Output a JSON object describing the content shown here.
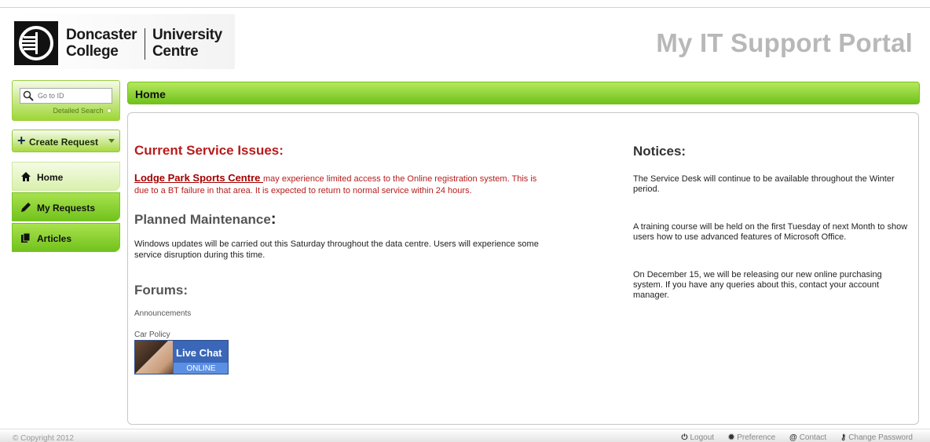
{
  "header": {
    "college_name": "Doncaster\nCollege",
    "university_name": "University\nCentre",
    "portal_title": "My IT Support Portal"
  },
  "sidebar": {
    "search_placeholder": "Go to ID",
    "detailed_search": "Detailed Search",
    "create_request": "Create Request",
    "items": [
      {
        "label": "Home",
        "icon": "home-icon"
      },
      {
        "label": "My Requests",
        "icon": "pencil-icon"
      },
      {
        "label": "Articles",
        "icon": "documents-icon"
      }
    ]
  },
  "main": {
    "page_title": "Home",
    "current_issues_title": "Current Service Issues:",
    "issue_link": "Lodge Park Sports Centre ",
    "issue_text": "may experience limited access to the Online registration system. This is due to a BT failure in that area. It is expected to return to normal service within 24 hours.",
    "planned_title": "Planned Maintenance",
    "planned_colon": ":",
    "planned_body": "Windows updates will be carried out this Saturday throughout the data centre. Users will experience some service disruption during this time.",
    "forums_title": "Forums:",
    "forums": [
      "Announcements",
      "Car Policy"
    ],
    "live_chat": {
      "title": "Live Chat",
      "status": "ONLINE"
    },
    "notices_title": "Notices:",
    "notices": [
      "The Service Desk will continue to be available throughout the Winter period.",
      "A training course will be held on the first Tuesday of next Month to show users how to use advanced features of Microsoft Office.",
      "On December 15, we will be releasing our new online purchasing system. If you have any queries about this, contact your account manager."
    ]
  },
  "footer": {
    "copyright": "© Copyright 2012",
    "links": [
      "Logout",
      "Preference",
      "Contact",
      "Change Password"
    ]
  },
  "colors": {
    "accent_green": "#7cc825",
    "issue_red": "#b81c1c",
    "portal_title_gray": "#b8b8b8"
  }
}
